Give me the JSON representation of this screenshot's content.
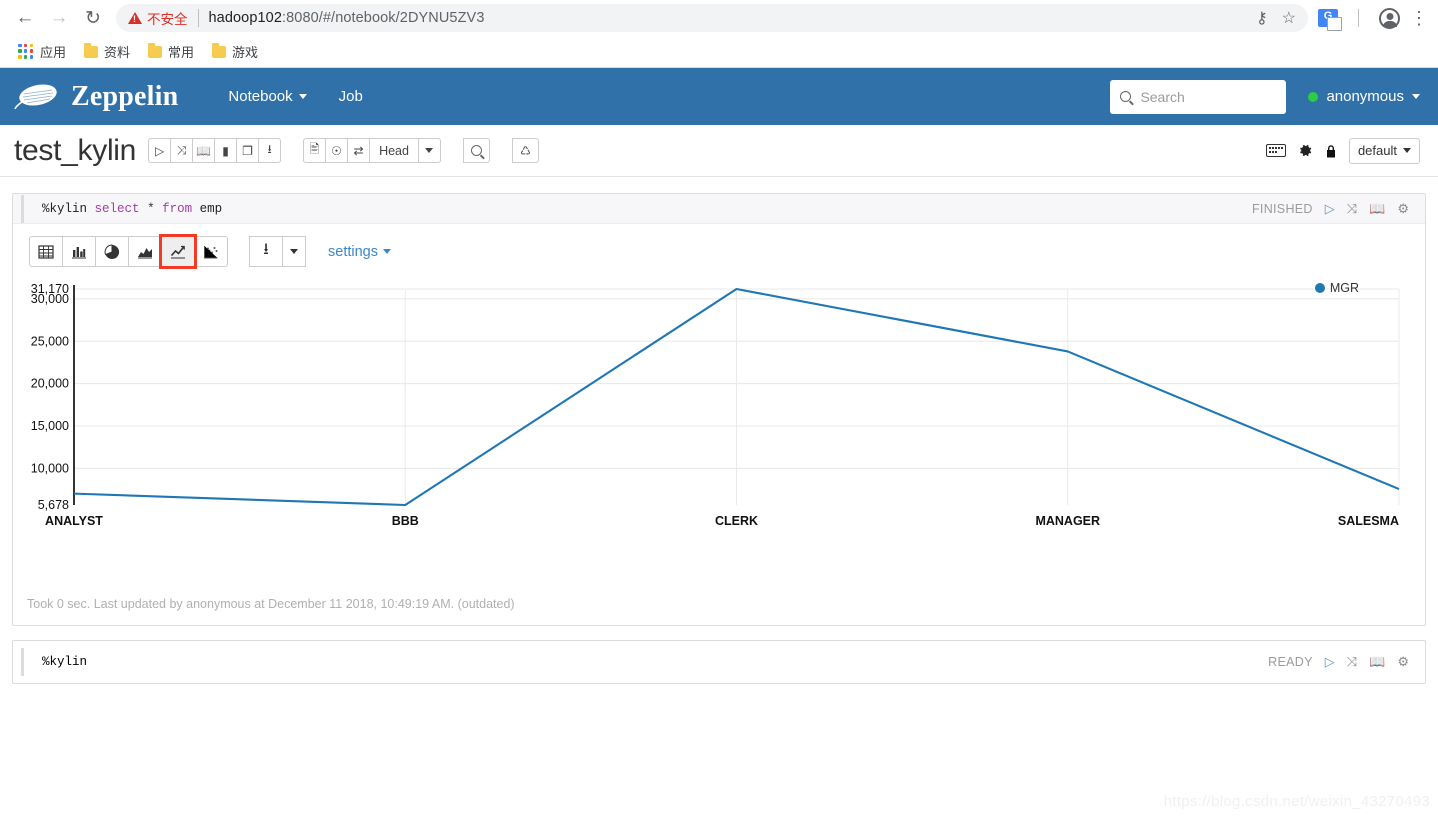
{
  "browser": {
    "back_icon": "back-arrow-icon",
    "forward_icon": "forward-arrow-icon",
    "reload_icon": "reload-icon",
    "security_label": "不安全",
    "url_host": "hadoop102",
    "url_rest": ":8080/#/notebook/2DYNU5ZV3",
    "bookmarks": [
      {
        "label": "应用",
        "icon": "apps-grid-icon"
      },
      {
        "label": "资料",
        "icon": "folder-icon"
      },
      {
        "label": "常用",
        "icon": "folder-icon"
      },
      {
        "label": "游戏",
        "icon": "folder-icon"
      }
    ],
    "toolbar_icons": [
      "key-icon",
      "star-icon",
      "google-translate-icon",
      "profile-icon",
      "kebab-menu-icon"
    ]
  },
  "navbar": {
    "brand": "Zeppelin",
    "links": [
      {
        "label": "Notebook",
        "has_caret": true
      },
      {
        "label": "Job",
        "has_caret": false
      }
    ],
    "search": {
      "placeholder": "Search",
      "value": ""
    },
    "user": {
      "label": "anonymous",
      "status_color": "#2ecc40"
    },
    "bg_color": "#3071a9"
  },
  "notebook": {
    "title": "test_kylin",
    "run_group": [
      {
        "icon": "run-all-icon",
        "title": "Run all paragraphs"
      },
      {
        "icon": "collapse-icon",
        "title": "Show/hide the code"
      },
      {
        "icon": "book-icon",
        "title": "Show/hide the output"
      },
      {
        "icon": "eraser-icon",
        "title": "Clear output"
      },
      {
        "icon": "clone-icon",
        "title": "Clone note"
      },
      {
        "icon": "export-icon",
        "title": "Export note"
      }
    ],
    "view_group": [
      {
        "icon": "report-icon"
      },
      {
        "icon": "clock-icon"
      },
      {
        "icon": "shortcut-icon"
      },
      {
        "label": "Head"
      },
      {
        "icon": "caret-down-icon"
      }
    ],
    "search_btn_icon": "search-icon",
    "trash_btn_icon": "trash-icon",
    "right_icons": [
      "keyboard-icon",
      "gear-icon",
      "lock-icon"
    ],
    "interpreter_binding": "default"
  },
  "paragraph1": {
    "code_magic": "%kylin",
    "code_keyword1": "select",
    "code_star": "*",
    "code_keyword2": "from",
    "code_table": "emp",
    "status": "FINISHED",
    "status_icons": [
      "run-icon",
      "collapse-icon",
      "book-icon",
      "gear-icon"
    ],
    "viz_buttons": [
      {
        "icon": "table-icon",
        "name": "table-chart",
        "active": false,
        "highlight": false
      },
      {
        "icon": "bar-chart-icon",
        "name": "bar-chart",
        "active": false,
        "highlight": false
      },
      {
        "icon": "pie-chart-icon",
        "name": "pie-chart",
        "active": false,
        "highlight": false
      },
      {
        "icon": "area-chart-icon",
        "name": "area-chart",
        "active": false,
        "highlight": false
      },
      {
        "icon": "line-chart-icon",
        "name": "line-chart",
        "active": true,
        "highlight": true
      },
      {
        "icon": "scatter-chart-icon",
        "name": "scatter-chart",
        "active": false,
        "highlight": false
      }
    ],
    "download_icon": "download-icon",
    "download_caret_icon": "caret-down-icon",
    "settings_label": "settings",
    "footer": "Took 0 sec. Last updated by anonymous at December 11 2018, 10:49:19 AM. (outdated)"
  },
  "paragraph2": {
    "code_magic": "%kylin",
    "status": "READY",
    "status_icons": [
      "run-icon",
      "collapse-icon",
      "book-icon",
      "gear-icon"
    ]
  },
  "watermark": "https://blog.csdn.net/weixin_43270493",
  "chart_data": {
    "type": "line",
    "title": "",
    "xlabel": "",
    "ylabel": "",
    "categories": [
      "ANALYST",
      "BBB",
      "CLERK",
      "MANAGER",
      "SALESMAN"
    ],
    "x_tick_labels": [
      "ANALYST",
      "BBB",
      "CLERK",
      "MANAGER",
      "SALESMA"
    ],
    "series": [
      {
        "name": "MGR",
        "color": "#1f77b4",
        "values": [
          7020,
          5678,
          31170,
          23800,
          7560
        ]
      }
    ],
    "legend": [
      "MGR"
    ],
    "legend_position": "top-right",
    "y_tick_labels": [
      "31,170",
      "30,000",
      "25,000",
      "20,000",
      "15,000",
      "10,000",
      "5,678"
    ],
    "y_tick_values": [
      31170,
      30000,
      25000,
      20000,
      15000,
      10000,
      5678
    ],
    "ylim": [
      5678,
      31170
    ],
    "grid": true
  }
}
